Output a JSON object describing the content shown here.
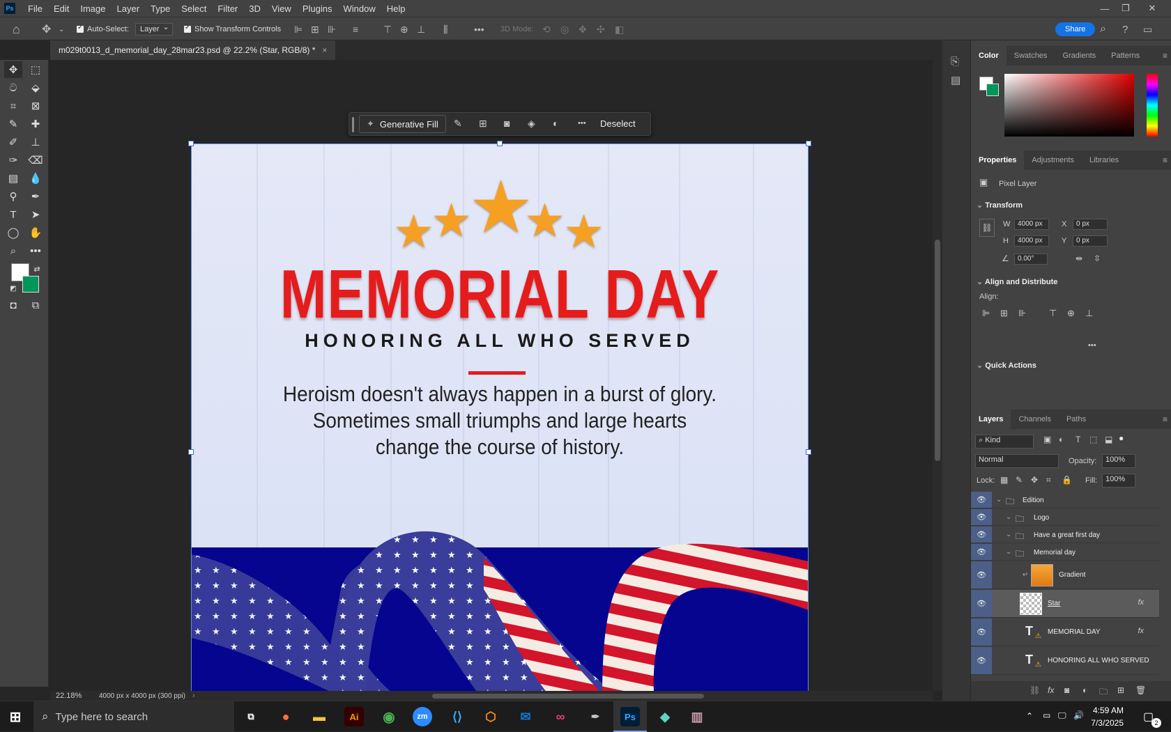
{
  "menubar": {
    "app_icon": "Ps",
    "items": [
      "File",
      "Edit",
      "Image",
      "Layer",
      "Type",
      "Select",
      "Filter",
      "3D",
      "View",
      "Plugins",
      "Window",
      "Help"
    ]
  },
  "options_bar": {
    "auto_select_label": "Auto-Select:",
    "auto_select_value": "Layer",
    "show_transform_label": "Show Transform Controls",
    "mode_3d_label": "3D Mode:",
    "share_label": "Share"
  },
  "document_tab": {
    "title": "m029t0013_d_memorial_day_28mar23.psd @ 22.2% (Star, RGB/8) *",
    "close": "×"
  },
  "context_bar": {
    "generative_fill": "Generative Fill",
    "more": "•••",
    "deselect": "Deselect"
  },
  "artwork": {
    "title": "MEMORIAL DAY",
    "subtitle": "HONORING ALL WHO SERVED",
    "quote_lines": [
      "Heroism doesn't always happen in a burst of glory.",
      "Sometimes small triumphs and large hearts",
      "change the course of history."
    ]
  },
  "status": {
    "zoom": "22.18%",
    "doc_info": "4000 px x 4000 px (300 ppi)"
  },
  "color_panel": {
    "tabs": [
      "Color",
      "Swatches",
      "Gradients",
      "Patterns"
    ],
    "foreground": "#ffffff",
    "background": "#00955a"
  },
  "properties_panel": {
    "tabs": [
      "Properties",
      "Adjustments",
      "Libraries"
    ],
    "kind": "Pixel Layer",
    "transform_title": "Transform",
    "w_label": "W",
    "w_value": "4000 px",
    "h_label": "H",
    "h_value": "4000 px",
    "x_label": "X",
    "x_value": "0 px",
    "y_label": "Y",
    "y_value": "0 px",
    "angle": "0.00°",
    "align_title": "Align and Distribute",
    "align_label": "Align:",
    "align_more": "•••",
    "quick_actions": "Quick Actions"
  },
  "layers_panel": {
    "tabs": [
      "Layers",
      "Channels",
      "Paths"
    ],
    "filter_kind": "Kind",
    "blend_mode": "Normal",
    "opacity_label": "Opacity:",
    "opacity_value": "100%",
    "lock_label": "Lock:",
    "fill_label": "Fill:",
    "fill_value": "100%",
    "layers": [
      {
        "name": "Edition",
        "type": "group",
        "indent": 0
      },
      {
        "name": "Logo",
        "type": "group",
        "indent": 1
      },
      {
        "name": "Have a great first day",
        "type": "group",
        "indent": 1
      },
      {
        "name": "Memorial day",
        "type": "group",
        "indent": 1
      },
      {
        "name": "Gradient",
        "type": "fill",
        "indent": 2
      },
      {
        "name": "Star",
        "type": "pixel",
        "indent": 2,
        "selected": true,
        "fx": "fx"
      },
      {
        "name": "MEMORIAL DAY",
        "type": "text",
        "indent": 2,
        "fx": "fx"
      },
      {
        "name": "HONORING ALL WHO SERVED",
        "type": "text",
        "indent": 2
      }
    ]
  },
  "taskbar": {
    "search_placeholder": "Type here to search",
    "time": "4:59 AM",
    "date": "7/3/2025",
    "notifications": "2",
    "apps": [
      "Ai",
      "zm",
      "Ps"
    ]
  }
}
